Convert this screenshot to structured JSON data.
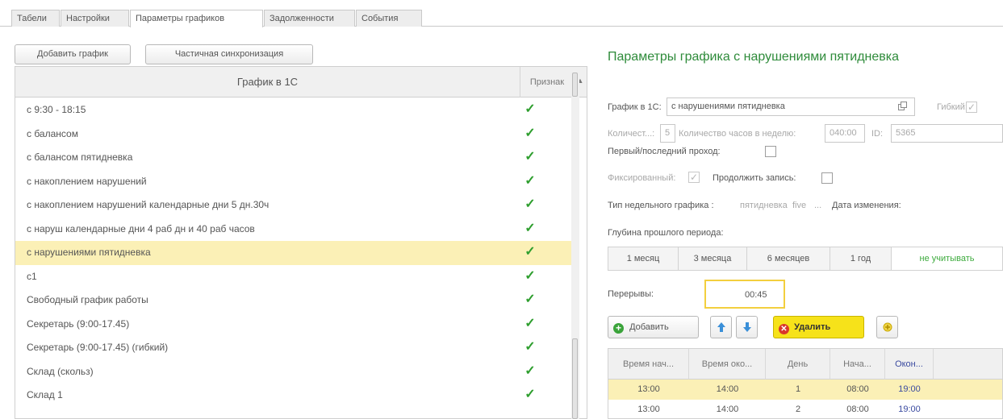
{
  "tabs": [
    {
      "label": "Табели"
    },
    {
      "label": "Настройки"
    },
    {
      "label": "Параметры графиков",
      "active": true
    },
    {
      "label": "Задолженности"
    },
    {
      "label": "События"
    }
  ],
  "toolbar": {
    "add_schedule": "Добавить график",
    "partial_sync": "Частичная синхронизация"
  },
  "grid": {
    "col_name": "График в 1С",
    "col_flag": "Признак",
    "sort_arrow": "▲",
    "check_mark": "✓",
    "rows": [
      {
        "name": "с 9:30 - 18:15",
        "flag": true
      },
      {
        "name": "с балансом",
        "flag": true
      },
      {
        "name": "с балансом пятидневка",
        "flag": true
      },
      {
        "name": "с накоплением нарушений",
        "flag": true
      },
      {
        "name": "с накоплением нарушений календарные дни 5 дн.30ч",
        "flag": true
      },
      {
        "name": "с наруш календарные дни 4 раб дн и 40 раб часов",
        "flag": true
      },
      {
        "name": "с нарушениями пятидневка",
        "flag": true,
        "selected": true
      },
      {
        "name": "с1",
        "flag": true
      },
      {
        "name": "Свободный график работы",
        "flag": true
      },
      {
        "name": "Секретарь (9:00-17.45)",
        "flag": true
      },
      {
        "name": "Секретарь (9:00-17.45) (гибкий)",
        "flag": true
      },
      {
        "name": "Склад (скольз)",
        "flag": true
      },
      {
        "name": "Склад 1",
        "flag": true
      }
    ]
  },
  "detail": {
    "title": "Параметры графика с нарушениями пятидневка",
    "schedule_label": "График в 1С:",
    "schedule_value": "с нарушениями пятидневка",
    "flexible_label": "Гибкий:",
    "count_label": "Количест...:",
    "count_value": "5",
    "hours_label": "Количество часов в неделю:",
    "hours_value": "040:00",
    "id_label": "ID:",
    "id_value": "5365",
    "first_last_label": "Первый/последний проход:",
    "fixed_label": "Фиксированный:",
    "continue_label": "Продолжить запись:",
    "week_type_label": "Тип недельного графика :",
    "week_type_value1": "пятидневка",
    "week_type_value2": "five",
    "week_type_ellipsis": "...",
    "change_date_label": "Дата изменения:",
    "depth_label": "Глубина прошлого периода:",
    "periods": [
      "1 месяц",
      "3 месяца",
      "6 месяцев",
      "1 год",
      "не учитывать"
    ],
    "breaks_label": "Перерывы:",
    "breaks_value": "00:45",
    "add_label": "Добавить",
    "delete_label": "Удалить"
  },
  "breaks_table": {
    "headers": [
      "Время нач...",
      "Время око...",
      "День",
      "Нача...",
      "Окон..."
    ],
    "rows": [
      [
        "13:00",
        "14:00",
        "1",
        "08:00",
        "19:00"
      ],
      [
        "13:00",
        "14:00",
        "2",
        "08:00",
        "19:00"
      ]
    ]
  },
  "colors": {
    "accent_green": "#2e8b3a",
    "selection": "#fbf0b6",
    "delete_yellow": "#f6e21a",
    "link_blue": "#3b4ba0"
  }
}
